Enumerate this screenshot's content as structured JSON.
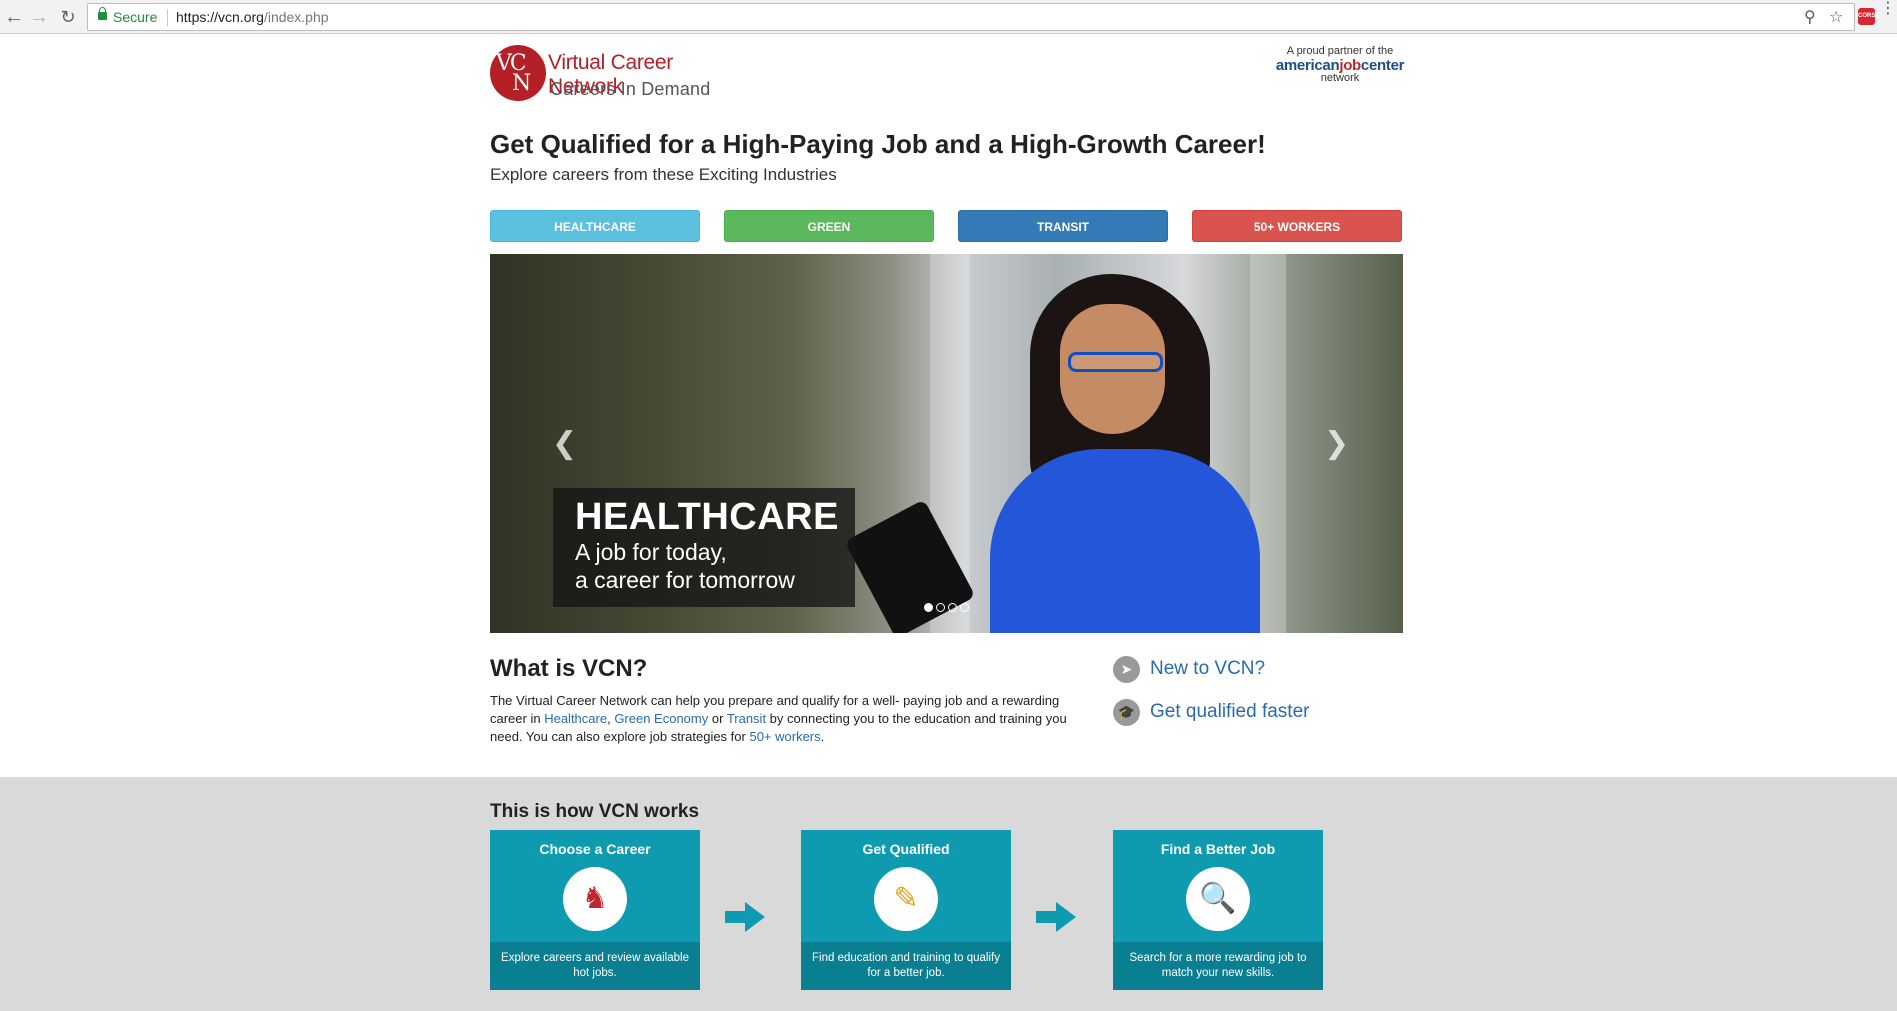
{
  "browser": {
    "secure_label": "Secure",
    "url_host": "https://vcn.org",
    "url_path": "/index.php",
    "ext_label": "CORS"
  },
  "logo": {
    "mark_top": "VC",
    "mark_bottom": "N",
    "title": "Virtual Career Network",
    "subtitle": "Careers In Demand"
  },
  "partner": {
    "line1": "A proud partner of the",
    "brand_a": "american",
    "brand_b": "job",
    "brand_c": "center",
    "line3": "network"
  },
  "hero": {
    "headline": "Get Qualified for a High-Paying Job and a High-Growth Career!",
    "subhead": "Explore careers from these Exciting Industries"
  },
  "industries": [
    {
      "label": "HEALTHCARE",
      "color": "#5bc0de"
    },
    {
      "label": "GREEN",
      "color": "#5cb85c"
    },
    {
      "label": "TRANSIT",
      "color": "#337ab7"
    },
    {
      "label": "50+ WORKERS",
      "color": "#d9534f"
    }
  ],
  "carousel": {
    "caption_title": "HEALTHCARE",
    "caption_line1": "A job for today,",
    "caption_line2": "a career for tomorrow",
    "slide_count": 4,
    "active_slide": 1
  },
  "what": {
    "title": "What is VCN?",
    "text_a": "The Virtual Career Network can help you prepare and qualify for a well- paying job and a rewarding career in ",
    "link_healthcare": "Healthcare",
    "sep1": ", ",
    "link_green": "Green Economy",
    "sep2": " or ",
    "link_transit": "Transit",
    "text_b": " by connecting you to the education and training you need. You can also explore job strategies for ",
    "link_50": "50+ workers",
    "text_c": "."
  },
  "side_links": [
    {
      "label": "New to VCN?",
      "icon": "signpost-icon"
    },
    {
      "label": "Get qualified faster",
      "icon": "graduation-cap-icon"
    }
  ],
  "how": {
    "title": "This is how VCN works",
    "steps": [
      {
        "title": "Choose a Career",
        "desc": "Explore careers and review available hot jobs.",
        "icon": "career-choice-icon"
      },
      {
        "title": "Get Qualified",
        "desc": "Find education and training to qualify for a better job.",
        "icon": "study-icon"
      },
      {
        "title": "Find a Better Job",
        "desc": "Search for a more rewarding job to match your new skills.",
        "icon": "job-search-icon"
      }
    ]
  }
}
